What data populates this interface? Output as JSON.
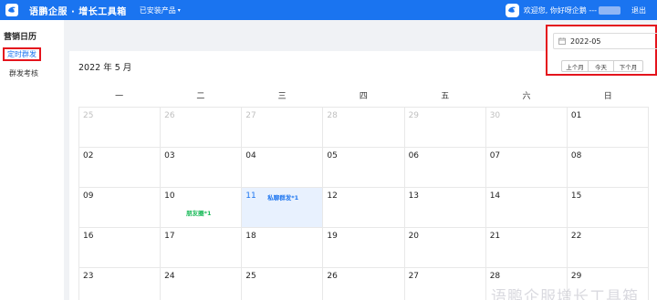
{
  "header": {
    "brand": "语鹏企服 · 增长工具箱",
    "installed_label": "已安装产品",
    "welcome": "欢迎您, 你好呀企鹅 ---",
    "logout": "退出",
    "color": "#1a74f0"
  },
  "sidebar": {
    "title": "营销日历",
    "items": [
      {
        "label": "定时群发",
        "active": true
      },
      {
        "label": "群发考核",
        "active": false
      }
    ]
  },
  "calendar": {
    "month_title": "2022 年 5 月",
    "weekdays": [
      "一",
      "二",
      "三",
      "四",
      "五",
      "六",
      "日"
    ],
    "weeks": [
      [
        {
          "day": "25",
          "other": true
        },
        {
          "day": "26",
          "other": true
        },
        {
          "day": "27",
          "other": true
        },
        {
          "day": "28",
          "other": true
        },
        {
          "day": "29",
          "other": true
        },
        {
          "day": "30",
          "other": true
        },
        {
          "day": "01"
        }
      ],
      [
        {
          "day": "02"
        },
        {
          "day": "03"
        },
        {
          "day": "04"
        },
        {
          "day": "05"
        },
        {
          "day": "06"
        },
        {
          "day": "07"
        },
        {
          "day": "08"
        }
      ],
      [
        {
          "day": "09"
        },
        {
          "day": "10",
          "event": "朋友圈*1",
          "event_color": "green"
        },
        {
          "day": "11",
          "today": true,
          "event": "私聊群发*1",
          "event_color": "blue"
        },
        {
          "day": "12"
        },
        {
          "day": "13"
        },
        {
          "day": "14"
        },
        {
          "day": "15"
        }
      ],
      [
        {
          "day": "16"
        },
        {
          "day": "17"
        },
        {
          "day": "18"
        },
        {
          "day": "19"
        },
        {
          "day": "20"
        },
        {
          "day": "21"
        },
        {
          "day": "22"
        }
      ],
      [
        {
          "day": "23"
        },
        {
          "day": "24"
        },
        {
          "day": "25"
        },
        {
          "day": "26"
        },
        {
          "day": "27"
        },
        {
          "day": "28"
        },
        {
          "day": "29"
        }
      ]
    ]
  },
  "picker": {
    "value": "2022-05",
    "prev_label": "上个月",
    "today_label": "今天",
    "next_label": "下个月"
  },
  "watermark": "语鹏企服增长工具箱",
  "icons": {
    "logo": "bird-logo-icon",
    "avatar": "bird-avatar-icon",
    "calendar": "calendar-icon",
    "dropdown": "chevron-down-icon"
  }
}
